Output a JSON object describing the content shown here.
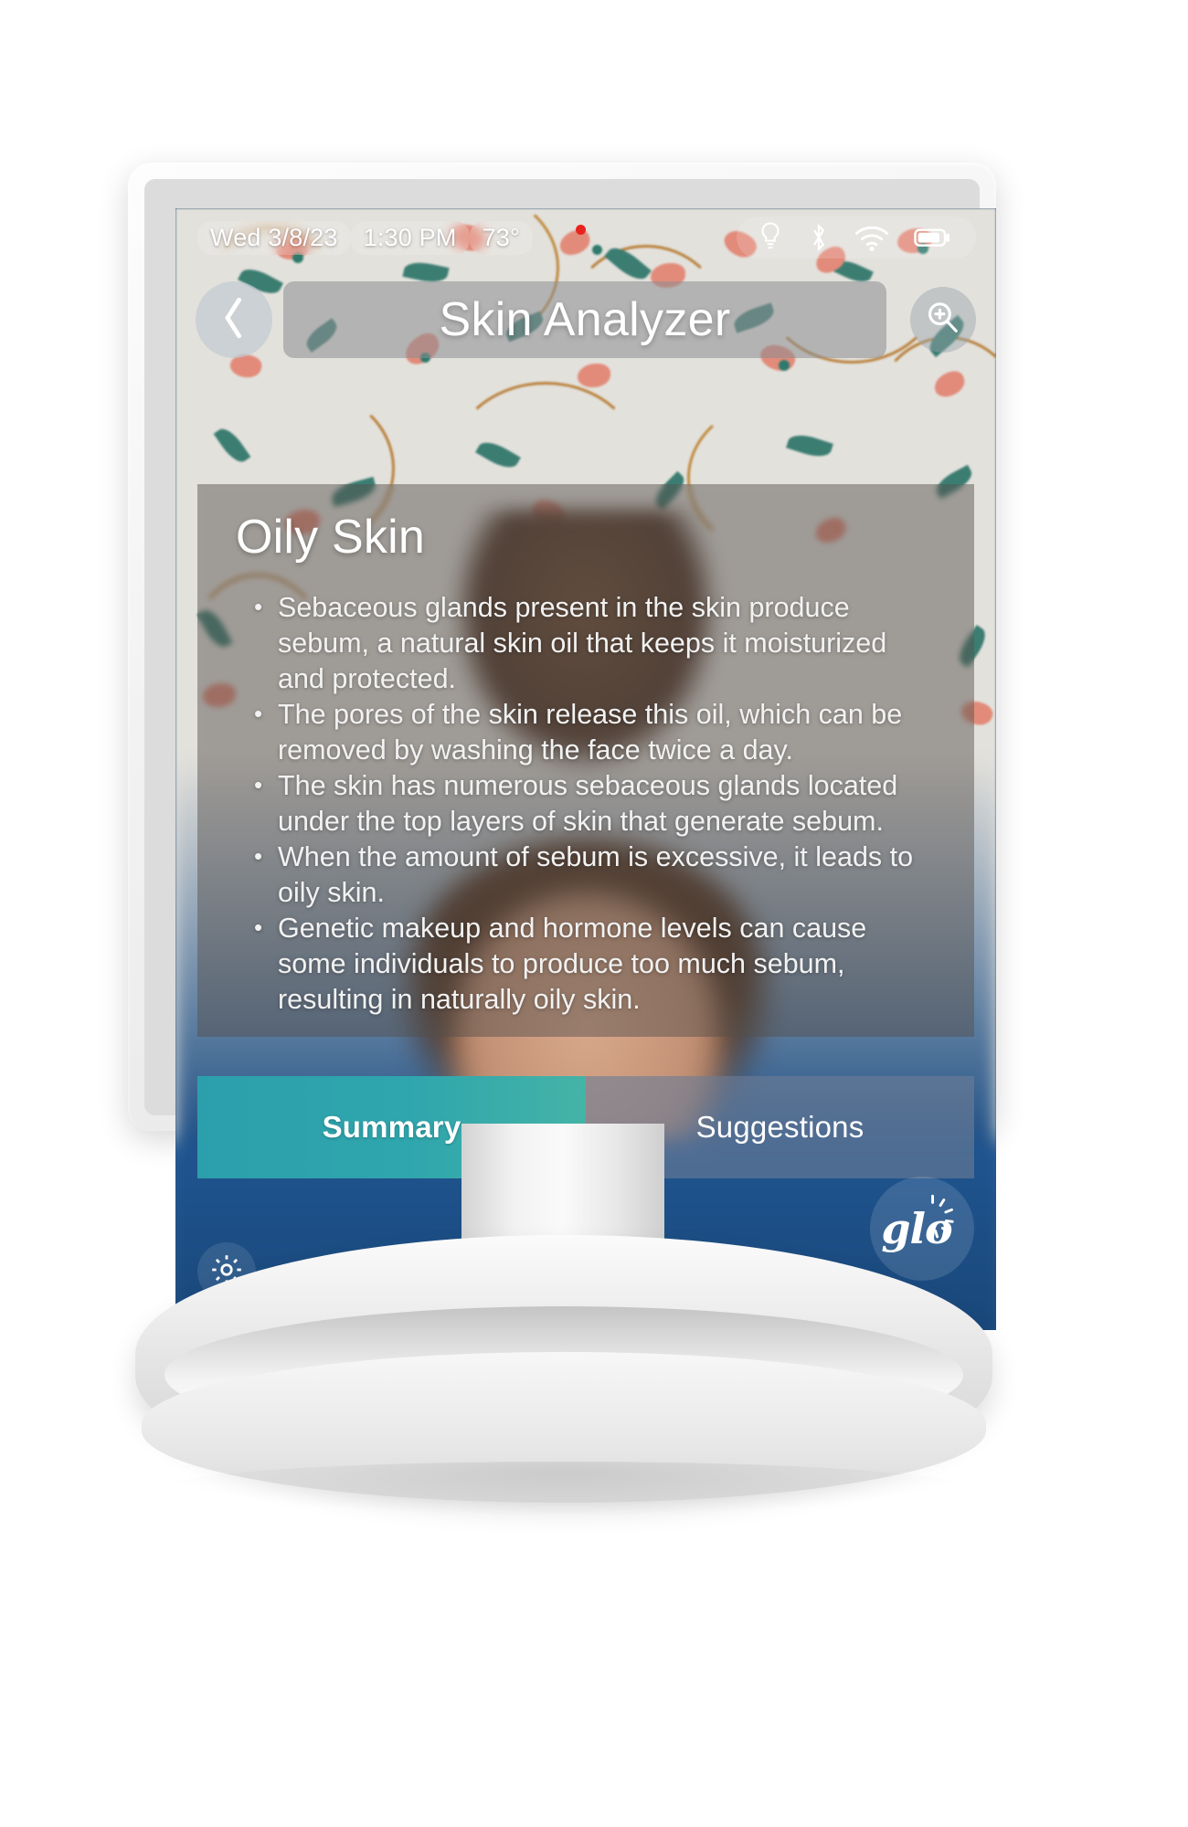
{
  "device": {
    "type": "desktop-monitor-kiosk"
  },
  "status_bar": {
    "date": "Wed 3/8/23",
    "time": "1:30 PM",
    "temperature": "73°",
    "icons": [
      "lightbulb-icon",
      "bluetooth-icon",
      "wifi-icon",
      "battery-icon"
    ],
    "notification_dot_color": "#e8231c"
  },
  "title_bar": {
    "back_icon": "chevron-left-icon",
    "title": "Skin Analyzer",
    "zoom_icon": "magnifier-plus-icon"
  },
  "card": {
    "heading": "Oily Skin",
    "bullets": [
      "Sebaceous glands present in the skin produce sebum, a natural skin oil that keeps it moisturized and protected.",
      "The pores of the skin release this oil, which can be removed by washing the face twice a day.",
      "The skin has numerous sebaceous glands located under the top layers of skin that generate sebum.",
      "When the amount of sebum is excessive, it leads to oily skin.",
      "Genetic makeup and hormone levels can cause some individuals to produce too much sebum, resulting in naturally oily skin."
    ]
  },
  "tabs": [
    {
      "label": "Summary",
      "active": true
    },
    {
      "label": "Suggestions",
      "active": false
    }
  ],
  "bottom_bar": {
    "settings_icon": "gear-icon",
    "power_icon": "power-icon",
    "logo_text": "glo",
    "logo_icon": "glo-sunburst-logo"
  },
  "colors": {
    "tab_active": "#2fa6ad",
    "tab_inactive": "#6c7c96",
    "screen_bottom": "#1b4b80",
    "card_overlay": "#56504c",
    "accent_red": "#e8231c",
    "bezel": "#f2f2f2"
  }
}
